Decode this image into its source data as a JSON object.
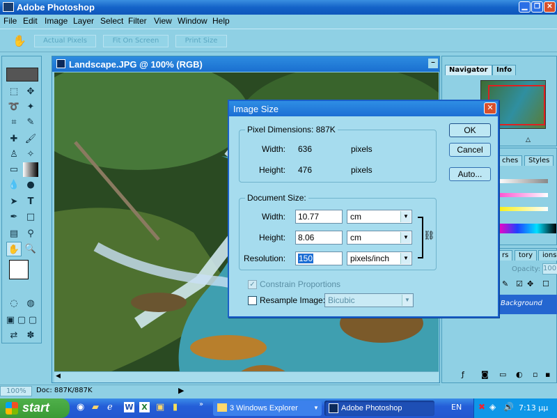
{
  "app": {
    "title": "Adobe Photoshop"
  },
  "menu": [
    "File",
    "Edit",
    "Image",
    "Layer",
    "Select",
    "Filter",
    "View",
    "Window",
    "Help"
  ],
  "options_bar": {
    "buttons": [
      "Actual Pixels",
      "Fit On Screen",
      "Print Size"
    ]
  },
  "document": {
    "title": "Landscape.JPG @ 100% (RGB)",
    "zoom": "100%",
    "doc_info": "Doc: 887K/887K"
  },
  "palettes": {
    "navigator_tabs": [
      "Navigator",
      "Info"
    ],
    "swatches_tabs": [
      "ches",
      "Styles"
    ],
    "layers_tabs": [
      "rs",
      "tory",
      "ions"
    ],
    "opacity_label": "Opacity:",
    "opacity_value": "100",
    "background_layer": "Background"
  },
  "dialog": {
    "title": "Image Size",
    "pixel_dimensions": {
      "label": "Pixel Dimensions:",
      "size": "887K",
      "width_label": "Width:",
      "width": "636",
      "width_unit": "pixels",
      "height_label": "Height:",
      "height": "476",
      "height_unit": "pixels"
    },
    "document_size": {
      "label": "Document Size:",
      "width_label": "Width:",
      "width": "10.77",
      "width_unit": "cm",
      "height_label": "Height:",
      "height": "8.06",
      "height_unit": "cm",
      "resolution_label": "Resolution:",
      "resolution": "150",
      "resolution_unit": "pixels/inch"
    },
    "constrain_label": "Constrain Proportions",
    "constrain_checked": true,
    "resample_label": "Resample Image:",
    "resample_checked": false,
    "resample_method": "Bicubic",
    "buttons": {
      "ok": "OK",
      "cancel": "Cancel",
      "auto": "Auto..."
    }
  },
  "taskbar": {
    "start": "start",
    "tasks": [
      {
        "label": "3 Windows Explorer"
      },
      {
        "label": "Adobe Photoshop"
      }
    ],
    "lang": "EN",
    "clock": "7:13 μμ"
  },
  "colors": {
    "accent": "#1c6ed4",
    "background": "#8fd0e4",
    "taskbar": "#245ed8",
    "start": "#3a9a35"
  }
}
